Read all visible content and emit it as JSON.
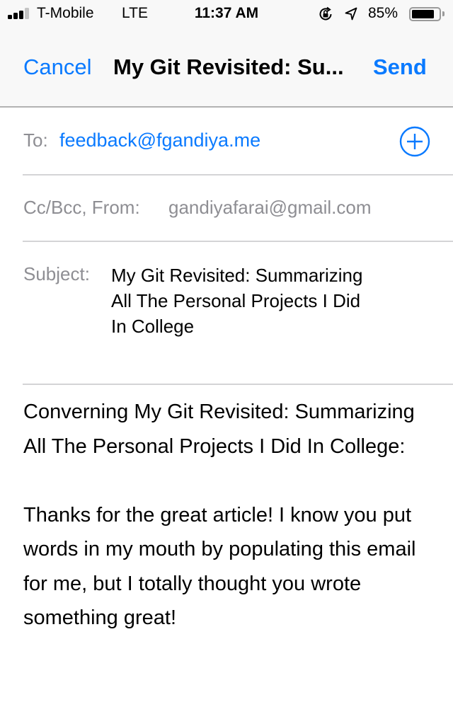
{
  "status_bar": {
    "signal_bars_filled": 3,
    "signal_bars_total": 4,
    "carrier": "T-Mobile",
    "network": "LTE",
    "time": "11:37 AM",
    "icons": [
      "rotation-lock-icon",
      "location-arrow-icon"
    ],
    "battery_percent_label": "85%",
    "battery_level": 0.85
  },
  "nav": {
    "cancel_label": "Cancel",
    "title": "My Git Revisited: Su...",
    "send_label": "Send"
  },
  "compose": {
    "to": {
      "label": "To:",
      "value": "feedback@fgandiya.me",
      "add_icon": "plus-circle-icon"
    },
    "cc_bcc_from": {
      "label": "Cc/Bcc, From:",
      "value": "gandiyafarai@gmail.com"
    },
    "subject": {
      "label": "Subject:",
      "value": "My Git Revisited: Summarizing All The Personal Projects I Did In College"
    },
    "body": {
      "paragraphs": [
        "Converning My Git Revisited: Summarizing All The Personal Projects I Did In College:",
        "Thanks for the great article! I know you put words in my mouth by populating this email for me, but I totally thought you wrote something great!"
      ]
    }
  },
  "colors": {
    "accent": "#0a7aff",
    "label_gray": "#8e8e93",
    "divider": "#d4d4d6",
    "bar_background": "#f8f8f8"
  }
}
